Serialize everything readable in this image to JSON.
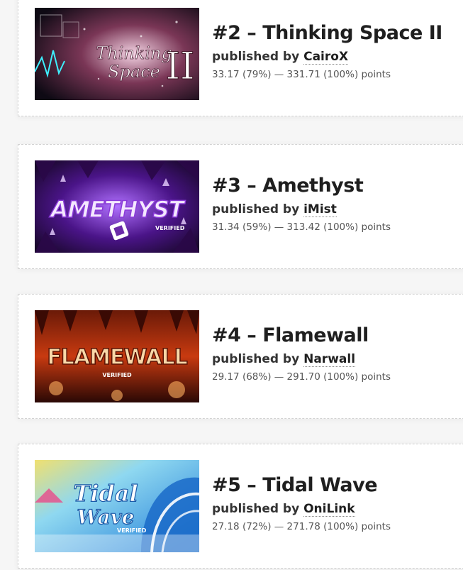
{
  "levels": [
    {
      "rank": "#2",
      "name": "Thinking Space II",
      "title": "#2 – Thinking Space II",
      "published_label": "published by",
      "publisher": "CairoX",
      "points": "33.17 (79%) — 331.71 (100%) points",
      "thumb_text": "Thinking Space II",
      "thumb_colors": [
        "#0e0a14",
        "#f0c8d8",
        "#5a2840"
      ]
    },
    {
      "rank": "#3",
      "name": "Amethyst",
      "title": "#3 – Amethyst",
      "published_label": "published by",
      "publisher": "iMist",
      "points": "31.34 (59%) — 313.42 (100%) points",
      "thumb_text": "AMETHYST",
      "thumb_colors": [
        "#12061e",
        "#8a3ad8",
        "#e8d0ff"
      ]
    },
    {
      "rank": "#4",
      "name": "Flamewall",
      "title": "#4 – Flamewall",
      "published_label": "published by",
      "publisher": "Narwall",
      "points": "29.17 (68%) — 291.70 (100%) points",
      "thumb_text": "FLAMEWALL",
      "thumb_colors": [
        "#2a0805",
        "#c83a10",
        "#ffb060"
      ]
    },
    {
      "rank": "#5",
      "name": "Tidal Wave",
      "title": "#5 – Tidal Wave",
      "published_label": "published by",
      "publisher": "OniLink",
      "points": "27.18 (72%) — 271.78 (100%) points",
      "thumb_text": "Tidal Wave",
      "thumb_colors": [
        "#1e7ad8",
        "#8fd8f0",
        "#f0e070"
      ]
    }
  ]
}
